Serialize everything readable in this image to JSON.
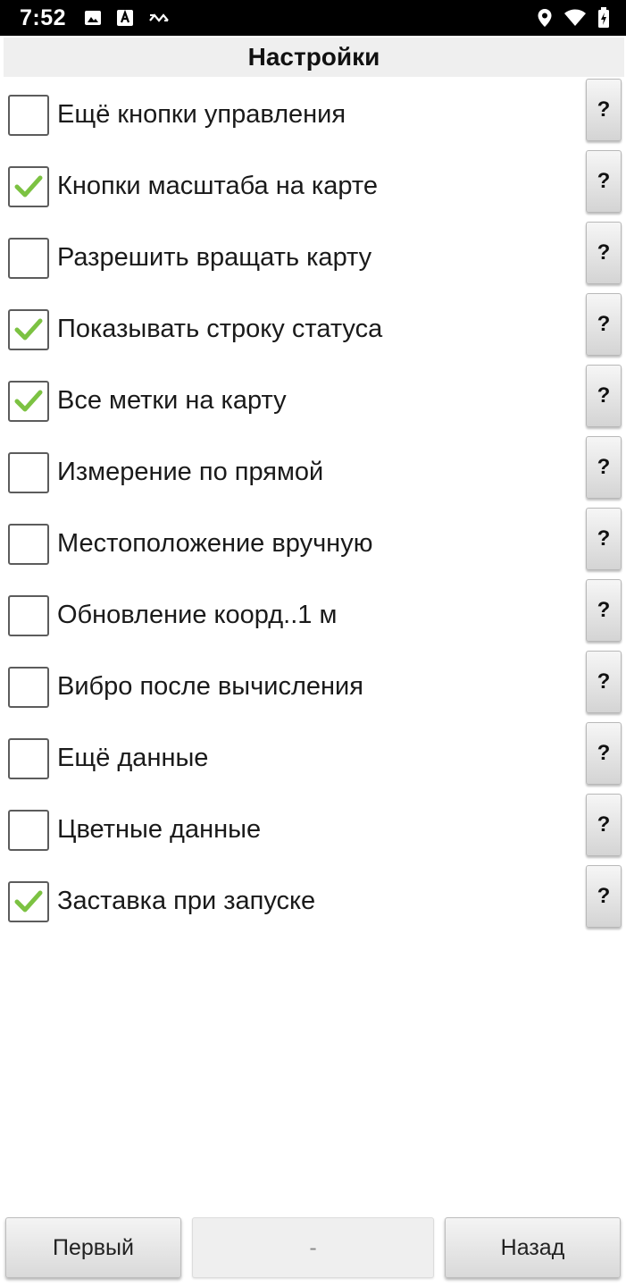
{
  "status_bar": {
    "time": "7:52",
    "left_icons": [
      "image-icon",
      "font-icon",
      "sync-icon"
    ],
    "right_icons": [
      "location-icon",
      "wifi-icon",
      "battery-charging-icon"
    ]
  },
  "header": {
    "title": "Настройки"
  },
  "settings": [
    {
      "label": "Ещё кнопки управления",
      "checked": false,
      "help": "?"
    },
    {
      "label": "Кнопки масштаба на карте",
      "checked": true,
      "help": "?"
    },
    {
      "label": "Разрешить вращать карту",
      "checked": false,
      "help": "?"
    },
    {
      "label": "Показывать строку статуса",
      "checked": true,
      "help": "?"
    },
    {
      "label": "Все метки на карту",
      "checked": true,
      "help": "?"
    },
    {
      "label": "Измерение по прямой",
      "checked": false,
      "help": "?"
    },
    {
      "label": "Местоположение вручную",
      "checked": false,
      "help": "?"
    },
    {
      "label": "Обновление коорд..1 м",
      "checked": false,
      "help": "?"
    },
    {
      "label": "Вибро после вычисления",
      "checked": false,
      "help": "?"
    },
    {
      "label": "Ещё данные",
      "checked": false,
      "help": "?"
    },
    {
      "label": "Цветные данные",
      "checked": false,
      "help": "?"
    },
    {
      "label": "Заставка при запуске",
      "checked": true,
      "help": "?"
    }
  ],
  "footer": {
    "first_label": "Первый",
    "middle_label": "-",
    "back_label": "Назад"
  },
  "colors": {
    "check_mark": "#7cc242",
    "checkbox_border": "#5c5c5c",
    "status_bar": "#000000",
    "title_bar": "#efefef"
  }
}
